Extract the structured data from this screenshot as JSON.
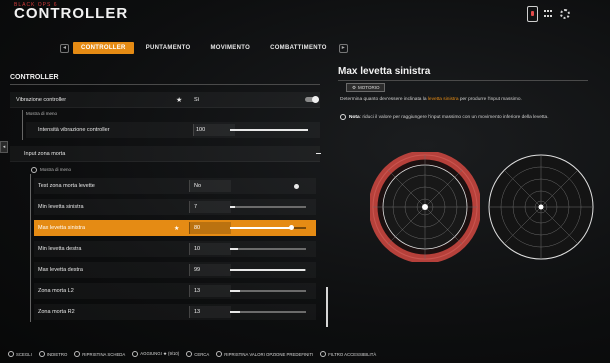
{
  "header": {
    "brand_small": "BLACK OPS 6",
    "brand_title": "CONTROLLER"
  },
  "tabs": [
    {
      "label": "CONTROLLER",
      "active": true
    },
    {
      "label": "PUNTAMENTO",
      "active": false
    },
    {
      "label": "MOVIMENTO",
      "active": false
    },
    {
      "label": "COMBATTIMENTO",
      "active": false
    }
  ],
  "left": {
    "section_title": "CONTROLLER",
    "vibration": {
      "label": "Vibrazione controller",
      "value": "Sì"
    },
    "show_less_1": "Mostra di meno",
    "vib_intensity": {
      "label": "Intensità vibrazione controller",
      "value": "100",
      "level": 1.0
    },
    "deadzone_input": {
      "label": "Input zona morta"
    },
    "show_less_2": "Mostra di meno",
    "rows": [
      {
        "label": "Test zona morta levette",
        "value": "No",
        "kind": "toggle",
        "level": 0.94
      },
      {
        "label": "Min levetta sinistra",
        "value": "7",
        "kind": "slider",
        "level": 0.07
      },
      {
        "label": "Max levetta sinistra",
        "value": "80",
        "kind": "slider",
        "level": 0.8,
        "active": true
      },
      {
        "label": "Min levetta destra",
        "value": "10",
        "kind": "slider",
        "level": 0.1
      },
      {
        "label": "Max levetta destra",
        "value": "99",
        "kind": "slider",
        "level": 0.99
      },
      {
        "label": "Zona morta L2",
        "value": "13",
        "kind": "slider",
        "level": 0.13
      },
      {
        "label": "Zona morta R2",
        "value": "13",
        "kind": "slider",
        "level": 0.13
      }
    ]
  },
  "right": {
    "title": "Max levetta sinistra",
    "chip": "MOTORIO",
    "desc_pre": "Determina quanto dev'essere inclinata la ",
    "desc_hl": "levetta sinistra",
    "desc_post": " per produrre l'input massimo.",
    "note_bold": "Nota",
    "note_text": ": riduci il valore per raggiungere l'input massimo con un movimento inferiore della levetta."
  },
  "footer": [
    {
      "icon": "cross-icon",
      "label": "SCEGLI"
    },
    {
      "icon": "circle-icon",
      "label": "INDIETRO"
    },
    {
      "icon": "reset-icon",
      "label": "RIPRISTINA SCHEDA"
    },
    {
      "icon": "favorite-icon",
      "label": "AGGIUNGI ★ (9/10)"
    },
    {
      "icon": "search-icon",
      "label": "CERCA"
    },
    {
      "icon": "restore-icon",
      "label": "RIPRISTINA VALORI OPZIONE PREDEFINITI"
    },
    {
      "icon": "filter-icon",
      "label": "FILTRO ACCESSIBILITÀ"
    }
  ],
  "colors": {
    "accent": "#e58b14",
    "stick_ring": "#c8463f"
  }
}
